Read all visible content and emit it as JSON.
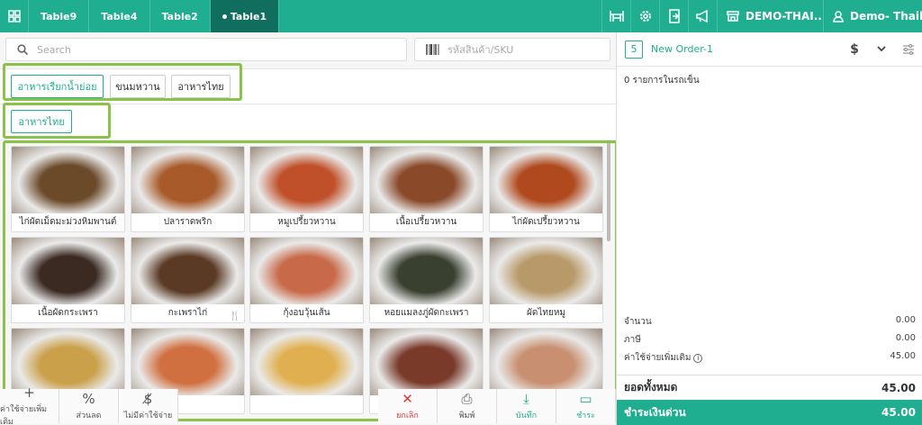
{
  "tabs": [
    "Table9",
    "Table4",
    "Table2",
    "Table1"
  ],
  "active_tab": "Table1",
  "topbar": {
    "store": "DEMO-THAI...",
    "user": "Demo- Thail..."
  },
  "search": {
    "placeholder": "Search"
  },
  "sku": {
    "placeholder": "รหัสสินค้า/SKU"
  },
  "categories": [
    "อาหารเรียกน้ำย่อย",
    "ขนมหวาน",
    "อาหารไทย"
  ],
  "subcategory": "อาหารไทย",
  "products": [
    {
      "name": "ไก่ผัดเม็ดมะม่วงหิมพานต์",
      "color": "#6b4a2a"
    },
    {
      "name": "ปลาราดพริก",
      "color": "#a85a2a"
    },
    {
      "name": "หมูเปรี้ยวหวาน",
      "color": "#c0502a"
    },
    {
      "name": "เนื้อเปรี้ยวหวาน",
      "color": "#8a4a2a"
    },
    {
      "name": "ไก่ผัดเปรี้ยวหวาน",
      "color": "#b04a1e"
    },
    {
      "name": "เนื้อผัดกระเพรา",
      "color": "#3a2a22"
    },
    {
      "name": "กะเพราไก่",
      "color": "#5a3a24",
      "badge": "🍴"
    },
    {
      "name": "กุ้งอบวุ้นเส้น",
      "color": "#c86a4a"
    },
    {
      "name": "หอยแมลงภู่ผัดกะเพรา",
      "color": "#3a4030"
    },
    {
      "name": "ผัดไทยหมู",
      "color": "#b89a6a"
    },
    {
      "name": "",
      "color": "#caa04a"
    },
    {
      "name": "",
      "color": "#d07040"
    },
    {
      "name": "",
      "color": "#e0b050"
    },
    {
      "name": "",
      "color": "#7a3a2a"
    },
    {
      "name": "",
      "color": "#c89070"
    }
  ],
  "actions": {
    "extra": "ค่าใช้จ่ายเพิ่มเติม",
    "discount": "ส่วนลด",
    "no_charge": "ไม่มีค่าใช้จ่าย",
    "cancel": "ยกเลิก",
    "print": "พิมพ์",
    "save": "บันทึก",
    "pay": "ชำระ"
  },
  "order": {
    "number": "5",
    "name": "New Order-1",
    "items_text": "0 รายการในรถเข็น",
    "quantity_label": "จำนวน",
    "quantity_value": "0.00",
    "tax_label": "ภาษี",
    "tax_value": "0.00",
    "extra_label": "ค่าใช้จ่ายเพิ่มเติม",
    "extra_value": "45.00",
    "total_label": "ยอดทั้งหมด",
    "total_value": "45.00",
    "pay_label": "ชำระเงินด่วน",
    "pay_value": "45.00"
  },
  "colors": {
    "accent": "#1fae8f",
    "highlight": "#8bc34a"
  }
}
